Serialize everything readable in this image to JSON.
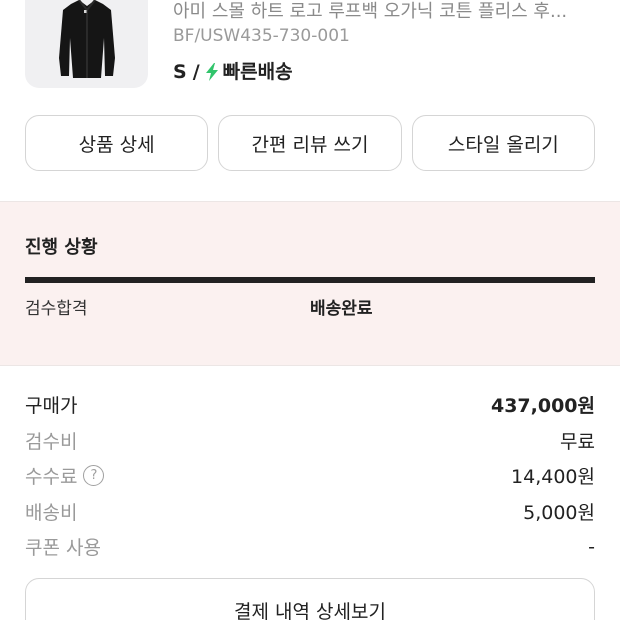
{
  "product": {
    "image_icon": "black-hoodie-image",
    "name": "아미 스몰 하트 로고 루프백 오가닉 코튼 플리스 후...",
    "code": "BF/USW435-730-001",
    "size": "S",
    "separator": "/",
    "delivery_icon": "lightning-bolt-icon",
    "delivery_color": "#31c46b",
    "delivery_label": "빠른배송"
  },
  "actions": {
    "detail": "상품 상세",
    "review": "간편 리뷰 쓰기",
    "style": "스타일 올리기"
  },
  "progress": {
    "title": "진행 상황",
    "steps": [
      "검수합격",
      "배송완료"
    ],
    "completion": 1.0
  },
  "payment": {
    "rows": [
      {
        "label": "구매가",
        "value": "437,000원"
      },
      {
        "label": "검수비",
        "value": "무료"
      },
      {
        "label": "수수료",
        "value": "14,400원",
        "help_icon": "question-circle-icon",
        "help_glyph": "?"
      },
      {
        "label": "배송비",
        "value": "5,000원"
      },
      {
        "label": "쿠폰 사용",
        "value": "-"
      }
    ],
    "detail_button": "결제 내역 상세보기"
  }
}
